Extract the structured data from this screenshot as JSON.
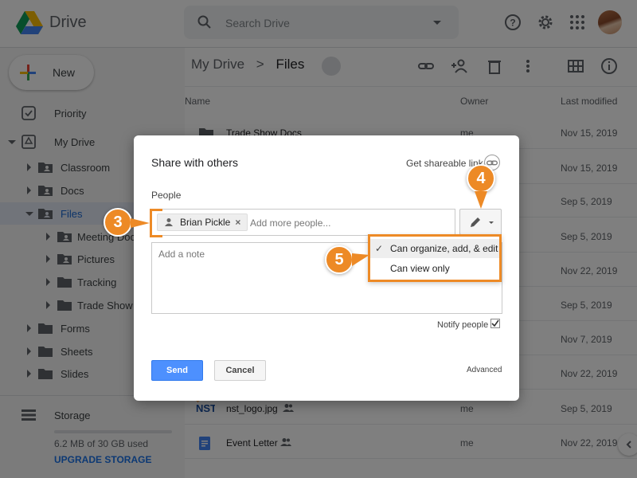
{
  "app": {
    "name": "Drive"
  },
  "search": {
    "placeholder": "Search Drive"
  },
  "topbar_icons": [
    "help-icon",
    "settings-icon",
    "apps-grid-icon",
    "avatar"
  ],
  "sidebar": {
    "new_label": "New",
    "items": [
      {
        "label": "Priority",
        "icon": "priority-icon"
      },
      {
        "label": "My Drive",
        "icon": "my-drive-icon"
      },
      {
        "label": "Classroom",
        "icon": "shared-folder-icon"
      },
      {
        "label": "Docs",
        "icon": "shared-folder-icon"
      },
      {
        "label": "Files",
        "icon": "shared-folder-icon"
      },
      {
        "label": "Meeting Doc",
        "icon": "shared-folder-icon"
      },
      {
        "label": "Pictures",
        "icon": "shared-folder-icon"
      },
      {
        "label": "Tracking",
        "icon": "folder-icon"
      },
      {
        "label": "Trade Show D",
        "icon": "folder-icon"
      },
      {
        "label": "Forms",
        "icon": "folder-icon"
      },
      {
        "label": "Sheets",
        "icon": "folder-icon"
      },
      {
        "label": "Slides",
        "icon": "folder-icon"
      }
    ],
    "storage_label": "Storage",
    "storage_used": "6.2 MB of 30 GB used",
    "storage_fraction": 0.0002,
    "upgrade_label": "UPGRADE STORAGE"
  },
  "breadcrumb": {
    "root": "My Drive",
    "separator": ">",
    "current": "Files"
  },
  "columns": {
    "name": "Name",
    "owner": "Owner",
    "modified": "Last modified"
  },
  "files": [
    {
      "name": "Trade Show Docs",
      "owner": "me",
      "modified": "Nov 15, 2019"
    },
    {
      "name": "",
      "owner": "",
      "modified": "Nov 15, 2019"
    },
    {
      "name": "",
      "owner": "",
      "modified": "Sep 5, 2019"
    },
    {
      "name": "",
      "owner": "",
      "modified": "Sep 5, 2019"
    },
    {
      "name": "",
      "owner": "",
      "modified": "Nov 22, 2019"
    },
    {
      "name": "",
      "owner": "",
      "modified": "Sep 5, 2019"
    },
    {
      "name": "",
      "owner": "",
      "modified": "Nov 7, 2019"
    },
    {
      "name": "",
      "owner": "",
      "modified": "Nov 22, 2019"
    },
    {
      "name": "nst_logo.jpg",
      "owner": "me",
      "modified": "Sep 5, 2019"
    },
    {
      "name": "Event Letter",
      "owner": "me",
      "modified": "Nov 22, 2019"
    }
  ],
  "dialog": {
    "title": "Share with others",
    "link_label": "Get shareable link",
    "people_label": "People",
    "chip_name": "Brian Pickle",
    "chip_remove": "×",
    "add_more_placeholder": "Add more people...",
    "note_placeholder": "Add a note",
    "notify_label": "Notify people",
    "send_label": "Send",
    "cancel_label": "Cancel",
    "advanced_label": "Advanced",
    "check_mark": "✓",
    "permission_options": [
      "Can organize, add, & edit",
      "Can view only"
    ]
  },
  "callouts": [
    "3",
    "4",
    "5"
  ],
  "colors": {
    "accent": "#ed8a26",
    "send": "#4d90fe",
    "selected_nav": "#e3e9f5"
  }
}
